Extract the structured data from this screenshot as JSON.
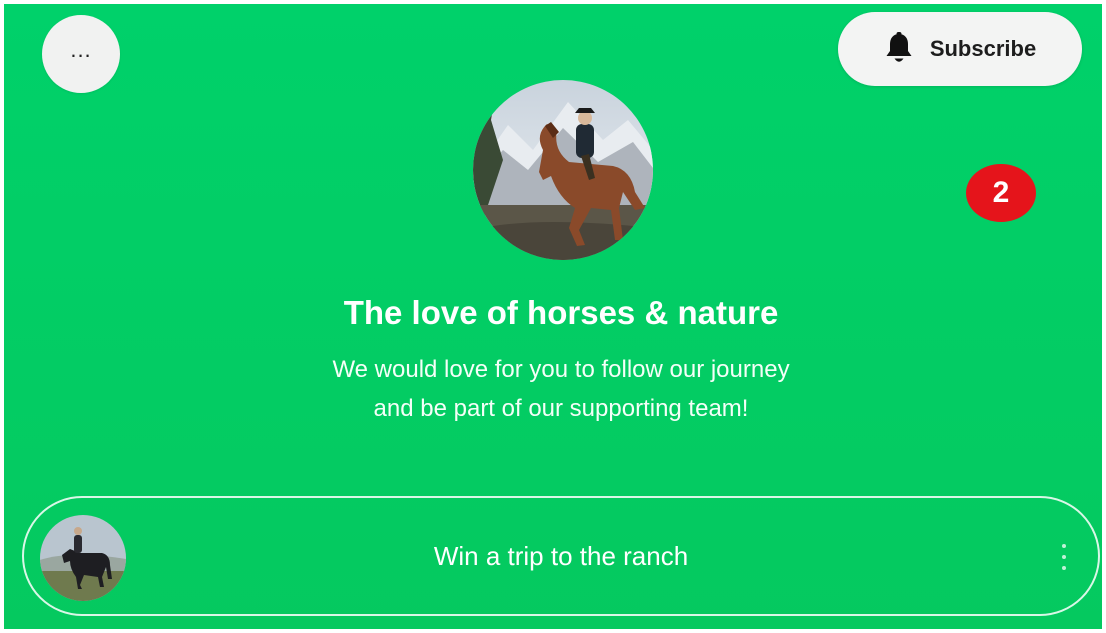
{
  "header": {
    "more_label": "...",
    "subscribe_label": "Subscribe"
  },
  "notification": {
    "count": "2",
    "color": "#e5141b"
  },
  "profile": {
    "title": "The love of horses & nature",
    "bio_line1": "We would love for you to follow our journey",
    "bio_line2": "and be part of our supporting team!"
  },
  "links": [
    {
      "label": "Win a trip to the ranch",
      "icon": "kebab-menu-icon"
    }
  ],
  "colors": {
    "background": "#00d16a",
    "button_bg": "#f3f4f3",
    "text": "#ffffff"
  }
}
